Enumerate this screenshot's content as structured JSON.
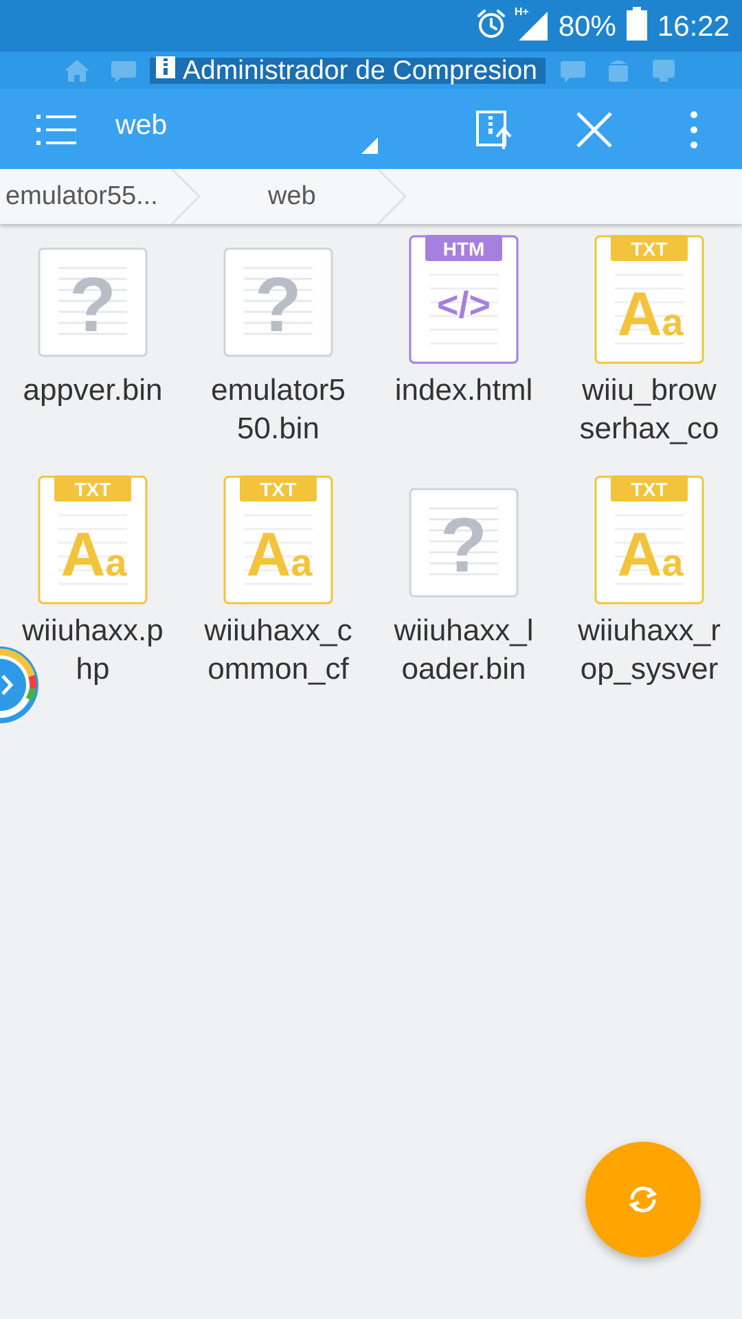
{
  "status_bar": {
    "network": "H+",
    "battery_percent": "80%",
    "time": "16:22"
  },
  "tabs": {
    "active_title": "Administrador de Compresion"
  },
  "toolbar": {
    "title": "web"
  },
  "breadcrumb": {
    "items": [
      "emulator55...",
      "web"
    ]
  },
  "files": [
    {
      "name_line1": "appver.bin",
      "name_line2": "",
      "type": "unknown",
      "badge": ""
    },
    {
      "name_line1": "emulator5",
      "name_line2": "50.bin",
      "type": "unknown",
      "badge": ""
    },
    {
      "name_line1": "index.html",
      "name_line2": "",
      "type": "html",
      "badge": "HTM"
    },
    {
      "name_line1": "wiiu_brow",
      "name_line2": "serhax_co",
      "type": "txt",
      "badge": "TXT"
    },
    {
      "name_line1": "wiiuhaxx.p",
      "name_line2": "hp",
      "type": "txt",
      "badge": "TXT"
    },
    {
      "name_line1": "wiiuhaxx_c",
      "name_line2": "ommon_cf",
      "type": "txt",
      "badge": "TXT"
    },
    {
      "name_line1": "wiiuhaxx_l",
      "name_line2": "oader.bin",
      "type": "unknown",
      "badge": ""
    },
    {
      "name_line1": "wiiuhaxx_r",
      "name_line2": "op_sysver",
      "type": "txt",
      "badge": "TXT"
    }
  ],
  "icon_glyphs": {
    "unknown": "?",
    "html": "</>",
    "txt_big": "A",
    "txt_small": "a"
  },
  "colors": {
    "status_bar": "#1e84cf",
    "toolbar": "#38a2f0",
    "txt_accent": "#f3c43b",
    "html_accent": "#a580e0",
    "fab": "#ffa400"
  }
}
